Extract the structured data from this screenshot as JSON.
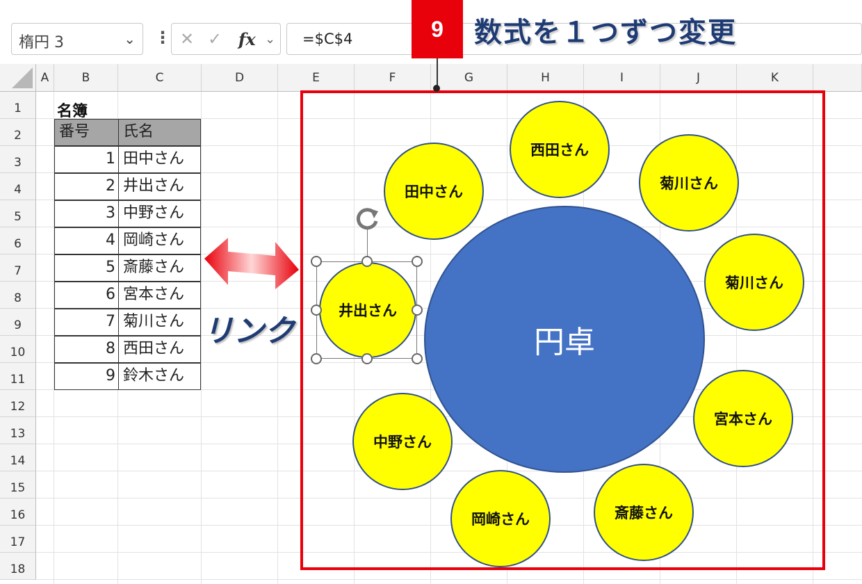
{
  "formula_bar": {
    "name_box": "楕円 3",
    "more_icon": "⋮",
    "cancel_icon": "✕",
    "enter_icon": "✓",
    "fx_label": "fx",
    "formula": "=$C$4"
  },
  "columns": [
    "A",
    "B",
    "C",
    "D",
    "E",
    "F",
    "G",
    "H",
    "I",
    "J",
    "K"
  ],
  "rows": [
    "1",
    "2",
    "3",
    "4",
    "5",
    "6",
    "7",
    "8",
    "9",
    "10",
    "11",
    "12",
    "13",
    "14",
    "15",
    "16",
    "17",
    "18"
  ],
  "sheet": {
    "title": "名簿",
    "headers": [
      "番号",
      "氏名"
    ],
    "entries": [
      {
        "no": "1",
        "name": "田中さん"
      },
      {
        "no": "2",
        "name": "井出さん"
      },
      {
        "no": "3",
        "name": "中野さん"
      },
      {
        "no": "4",
        "name": "岡崎さん"
      },
      {
        "no": "5",
        "name": "斎藤さん"
      },
      {
        "no": "6",
        "name": "宮本さん"
      },
      {
        "no": "7",
        "name": "菊川さん"
      },
      {
        "no": "8",
        "name": "西田さん"
      },
      {
        "no": "9",
        "name": "鈴木さん"
      }
    ]
  },
  "annotation": {
    "step": "9",
    "headline": "数式を１つずつ変更",
    "link_label": "リンク",
    "accent_color": "#e8000b",
    "headline_color": "#1f3b73"
  },
  "diagram": {
    "table_label": "円卓",
    "seats": {
      "nishida": "西田さん",
      "tanaka": "田中さん",
      "kikukawa_top": "菊川さん",
      "kikukawa_right": "菊川さん",
      "ide": "井出さん",
      "miyamoto": "宮本さん",
      "nakano": "中野さん",
      "okazaki": "岡崎さん",
      "saito": "斎藤さん"
    },
    "seat_color": "#ffff00",
    "table_color": "#4472c4"
  }
}
